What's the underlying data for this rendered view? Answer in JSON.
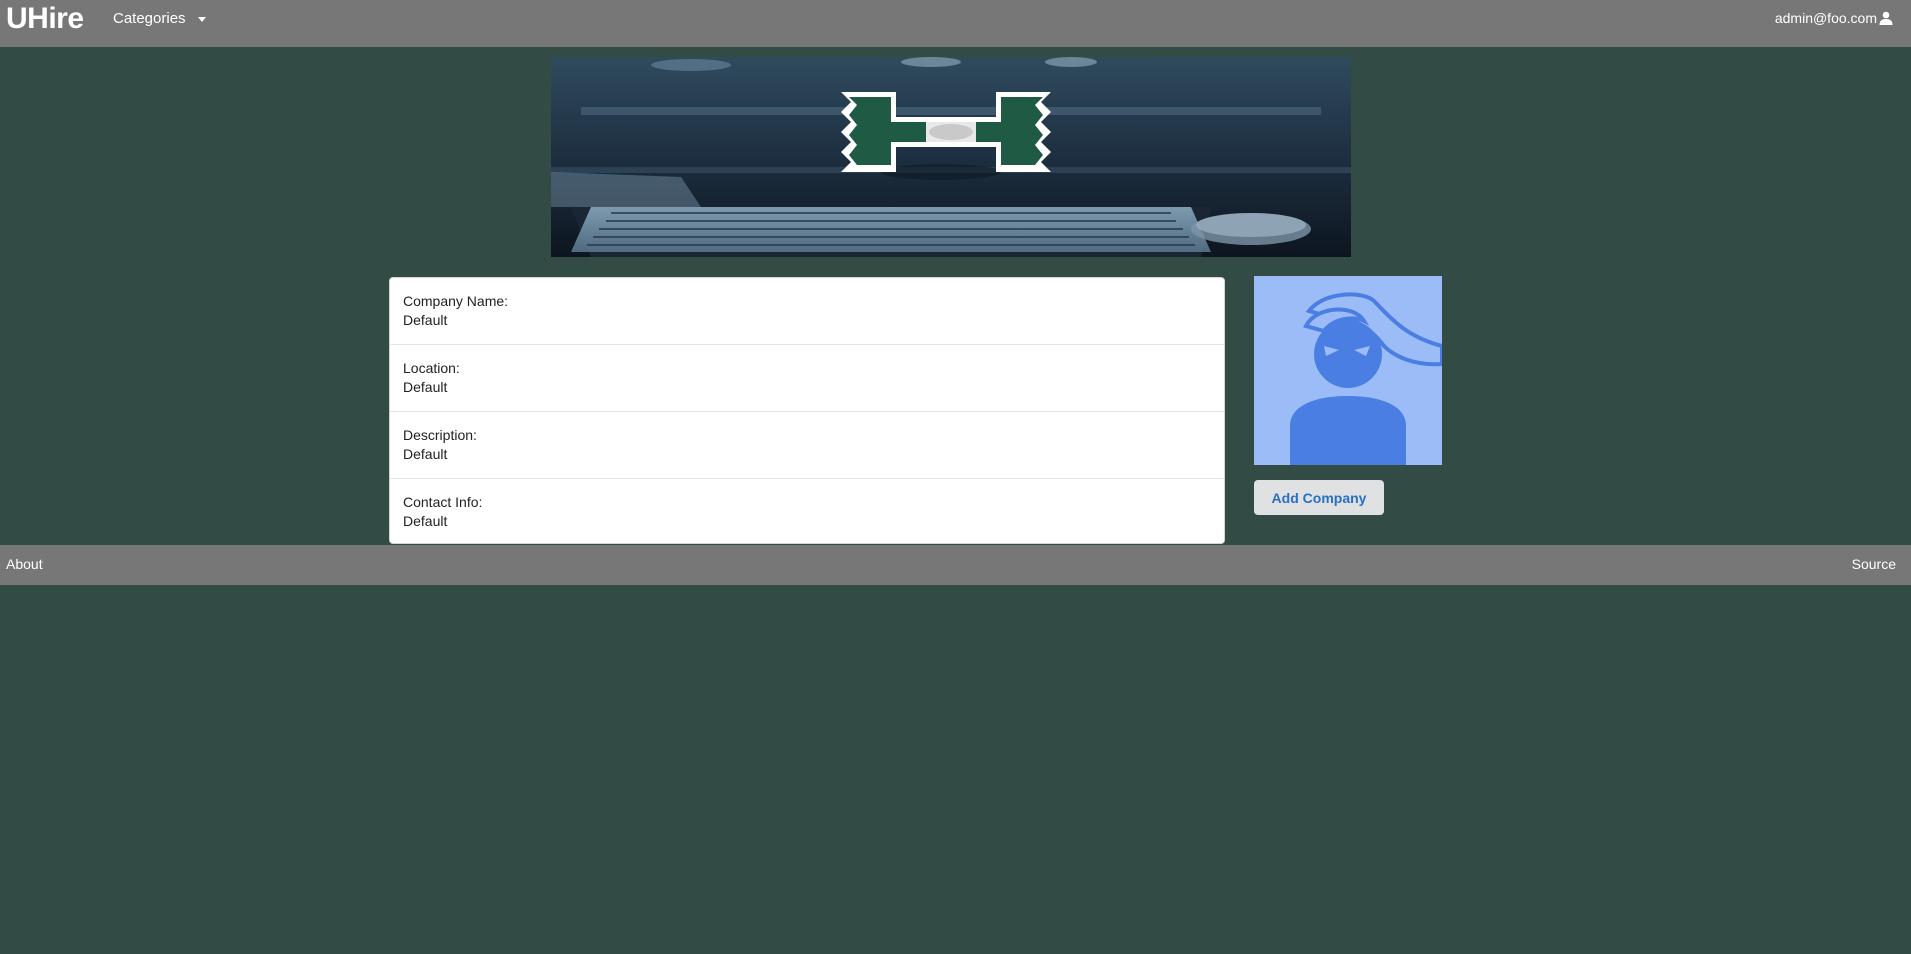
{
  "navbar": {
    "brand": "UHire",
    "categories_label": "Categories",
    "user_email": "admin@foo.com"
  },
  "company": {
    "fields": [
      {
        "label": "Company Name:",
        "value": "Default"
      },
      {
        "label": "Location:",
        "value": "Default"
      },
      {
        "label": "Description:",
        "value": "Default"
      },
      {
        "label": "Contact Info:",
        "value": "Default"
      }
    ]
  },
  "actions": {
    "add_company_label": "Add Company"
  },
  "footer": {
    "about_label": "About",
    "source_label": "Source"
  },
  "colors": {
    "background": "#324c45",
    "navbar": "#777777",
    "accent": "#2b6fc4",
    "avatar_bg": "#9cbcf7",
    "avatar_fg": "#4a7ee2",
    "logo_green": "#1f5a44"
  },
  "icons": {
    "user": "user-icon",
    "dropdown": "caret-down-icon"
  }
}
